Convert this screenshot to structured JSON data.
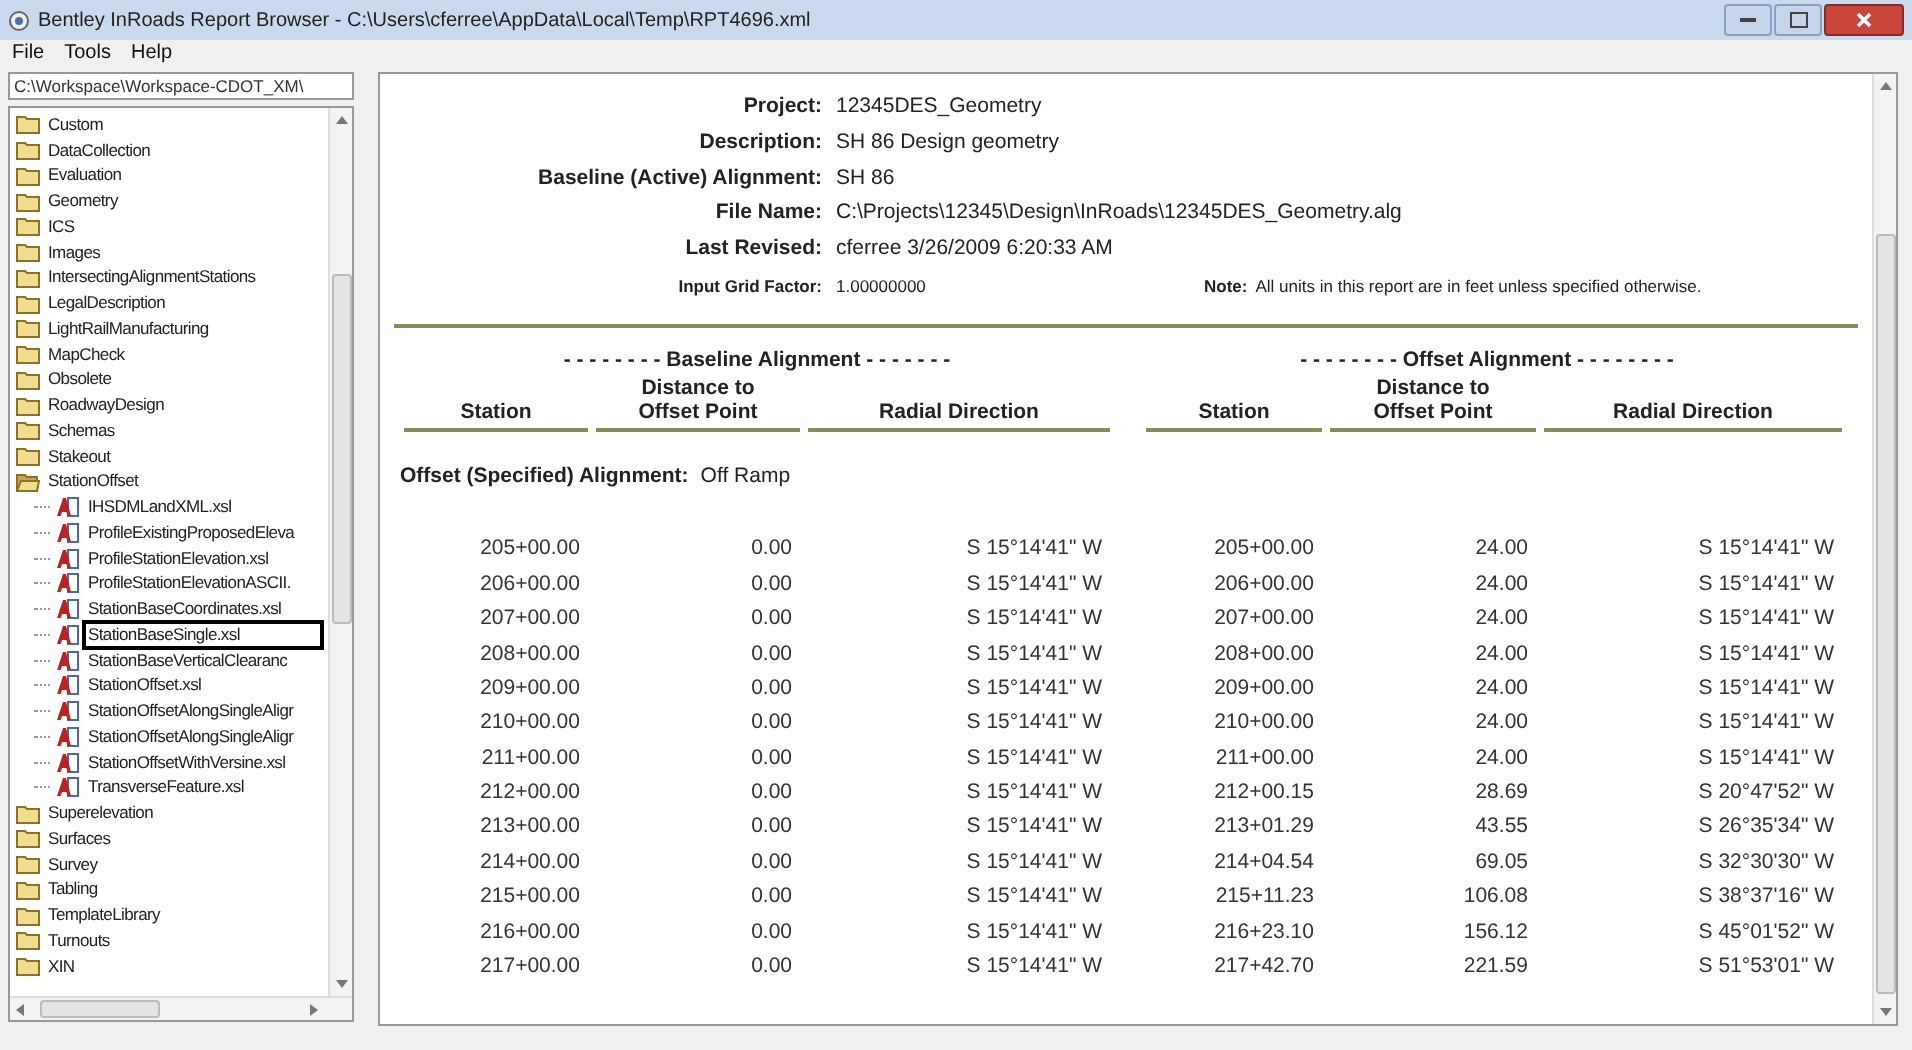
{
  "window": {
    "title": "Bentley InRoads Report Browser - C:\\Users\\cferree\\AppData\\Local\\Temp\\RPT4696.xml"
  },
  "menu": [
    "File",
    "Tools",
    "Help"
  ],
  "path_field": {
    "value": "C:\\Workspace\\Workspace-CDOT_XM\\"
  },
  "tree": [
    {
      "kind": "folder",
      "label": "Custom",
      "expanded": false,
      "selected": false
    },
    {
      "kind": "folder",
      "label": "DataCollection",
      "expanded": false,
      "selected": false
    },
    {
      "kind": "folder",
      "label": "Evaluation",
      "expanded": false,
      "selected": false
    },
    {
      "kind": "folder",
      "label": "Geometry",
      "expanded": false,
      "selected": false
    },
    {
      "kind": "folder",
      "label": "ICS",
      "expanded": false,
      "selected": false
    },
    {
      "kind": "folder",
      "label": "Images",
      "expanded": false,
      "selected": false
    },
    {
      "kind": "folder",
      "label": "IntersectingAlignmentStations",
      "expanded": false,
      "selected": false
    },
    {
      "kind": "folder",
      "label": "LegalDescription",
      "expanded": false,
      "selected": false
    },
    {
      "kind": "folder",
      "label": "LightRailManufacturing",
      "expanded": false,
      "selected": false
    },
    {
      "kind": "folder",
      "label": "MapCheck",
      "expanded": false,
      "selected": false
    },
    {
      "kind": "folder",
      "label": "Obsolete",
      "expanded": false,
      "selected": false
    },
    {
      "kind": "folder",
      "label": "RoadwayDesign",
      "expanded": false,
      "selected": false
    },
    {
      "kind": "folder",
      "label": "Schemas",
      "expanded": false,
      "selected": false
    },
    {
      "kind": "folder",
      "label": "Stakeout",
      "expanded": false,
      "selected": false
    },
    {
      "kind": "folder",
      "label": "StationOffset",
      "expanded": true,
      "selected": false,
      "children": [
        {
          "kind": "file",
          "label": "IHSDMLandXML.xsl",
          "selected": false
        },
        {
          "kind": "file",
          "label": "ProfileExistingProposedEleva",
          "selected": false
        },
        {
          "kind": "file",
          "label": "ProfileStationElevation.xsl",
          "selected": false
        },
        {
          "kind": "file",
          "label": "ProfileStationElevationASCII.",
          "selected": false
        },
        {
          "kind": "file",
          "label": "StationBaseCoordinates.xsl",
          "selected": false
        },
        {
          "kind": "file",
          "label": "StationBaseSingle.xsl",
          "selected": true
        },
        {
          "kind": "file",
          "label": "StationBaseVerticalClearanc",
          "selected": false
        },
        {
          "kind": "file",
          "label": "StationOffset.xsl",
          "selected": false
        },
        {
          "kind": "file",
          "label": "StationOffsetAlongSingleAligr",
          "selected": false
        },
        {
          "kind": "file",
          "label": "StationOffsetAlongSingleAligr",
          "selected": false
        },
        {
          "kind": "file",
          "label": "StationOffsetWithVersine.xsl",
          "selected": false
        },
        {
          "kind": "file",
          "label": "TransverseFeature.xsl",
          "selected": false
        }
      ]
    },
    {
      "kind": "folder",
      "label": "Superelevation",
      "expanded": false,
      "selected": false
    },
    {
      "kind": "folder",
      "label": "Surfaces",
      "expanded": false,
      "selected": false
    },
    {
      "kind": "folder",
      "label": "Survey",
      "expanded": false,
      "selected": false
    },
    {
      "kind": "folder",
      "label": "Tabling",
      "expanded": false,
      "selected": false
    },
    {
      "kind": "folder",
      "label": "TemplateLibrary",
      "expanded": false,
      "selected": false
    },
    {
      "kind": "folder",
      "label": "Turnouts",
      "expanded": false,
      "selected": false
    },
    {
      "kind": "folder",
      "label": "XIN",
      "expanded": false,
      "selected": false
    }
  ],
  "report": {
    "fields": [
      {
        "kind": "main",
        "label": "Project:",
        "value": "12345DES_Geometry"
      },
      {
        "kind": "main",
        "label": "Description:",
        "value": "SH 86 Design geometry"
      },
      {
        "kind": "main",
        "label": "Baseline (Active) Alignment:",
        "value": "SH 86"
      },
      {
        "kind": "main",
        "label": "File Name:",
        "value": "C:\\Projects\\12345\\Design\\InRoads\\12345DES_Geometry.alg"
      },
      {
        "kind": "main",
        "label": "Last Revised:",
        "value": "cferree 3/26/2009 6:20:33 AM"
      },
      {
        "kind": "small",
        "label": "Input Grid Factor:",
        "value": "1.00000000"
      }
    ],
    "note": {
      "label": "Note:",
      "text": "All units in this report are in feet unless specified otherwise."
    },
    "groups": [
      "- - - - - - - - Baseline Alignment - - - - - - -",
      "- - - - - - - - Offset Alignment - - - - - - - -"
    ],
    "columns": [
      "Station",
      "Distance to Offset Point",
      "Radial Direction",
      "Station",
      "Distance to Offset Point",
      "Radial Direction"
    ],
    "alignment": {
      "label": "Offset (Specified) Alignment:",
      "value": "Off Ramp"
    },
    "rows": [
      [
        "205+00.00",
        "0.00",
        "S 15°14'41\" W",
        "205+00.00",
        "24.00",
        "S 15°14'41\" W"
      ],
      [
        "206+00.00",
        "0.00",
        "S 15°14'41\" W",
        "206+00.00",
        "24.00",
        "S 15°14'41\" W"
      ],
      [
        "207+00.00",
        "0.00",
        "S 15°14'41\" W",
        "207+00.00",
        "24.00",
        "S 15°14'41\" W"
      ],
      [
        "208+00.00",
        "0.00",
        "S 15°14'41\" W",
        "208+00.00",
        "24.00",
        "S 15°14'41\" W"
      ],
      [
        "209+00.00",
        "0.00",
        "S 15°14'41\" W",
        "209+00.00",
        "24.00",
        "S 15°14'41\" W"
      ],
      [
        "210+00.00",
        "0.00",
        "S 15°14'41\" W",
        "210+00.00",
        "24.00",
        "S 15°14'41\" W"
      ],
      [
        "211+00.00",
        "0.00",
        "S 15°14'41\" W",
        "211+00.00",
        "24.00",
        "S 15°14'41\" W"
      ],
      [
        "212+00.00",
        "0.00",
        "S 15°14'41\" W",
        "212+00.15",
        "28.69",
        "S 20°47'52\" W"
      ],
      [
        "213+00.00",
        "0.00",
        "S 15°14'41\" W",
        "213+01.29",
        "43.55",
        "S 26°35'34\" W"
      ],
      [
        "214+00.00",
        "0.00",
        "S 15°14'41\" W",
        "214+04.54",
        "69.05",
        "S 32°30'30\" W"
      ],
      [
        "215+00.00",
        "0.00",
        "S 15°14'41\" W",
        "215+11.23",
        "106.08",
        "S 38°37'16\" W"
      ],
      [
        "216+00.00",
        "0.00",
        "S 15°14'41\" W",
        "216+23.10",
        "156.12",
        "S 45°01'52\" W"
      ],
      [
        "217+00.00",
        "0.00",
        "S 15°14'41\" W",
        "217+42.70",
        "221.59",
        "S 51°53'01\" W"
      ]
    ]
  }
}
